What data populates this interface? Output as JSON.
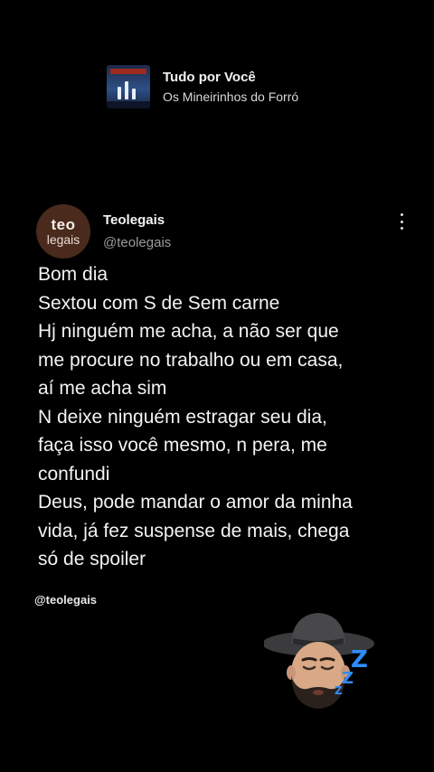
{
  "music": {
    "title": "Tudo por Você",
    "artist": "Os Mineirinhos do Forró",
    "icon": "album-cover"
  },
  "tweet": {
    "avatar": {
      "line1": "teo",
      "line2": "legais",
      "bg": "#4a2a1c"
    },
    "name": "Teolegais",
    "handle": "@teolegais",
    "lines": [
      "Bom dia",
      "Sextou com S de Sem carne",
      "Hj ninguém me acha, a não ser que",
      "me procure no trabalho ou em casa,",
      "aí me acha sim",
      "N deixe ninguém estragar seu dia,",
      "faça isso você mesmo, n pera, me",
      "confundi",
      "Deus, pode mandar o amor da minha",
      "vida, já fez suspense de mais, chega",
      "só de spoiler"
    ]
  },
  "watermark": "@teolegais",
  "sticker": {
    "icon": "sleeping-cowboy-memoji",
    "zzz": "Z"
  }
}
